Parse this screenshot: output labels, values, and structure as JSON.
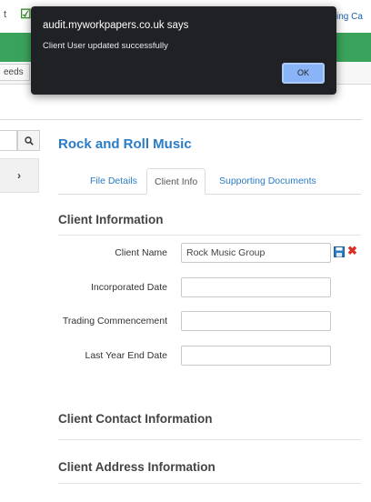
{
  "browser": {
    "bookmark_left": "t",
    "bookmark_right": "ing Ca"
  },
  "header": {
    "tab_label": "eeds"
  },
  "sidebar": {
    "search_icon": "magnifier-icon",
    "expand_icon": "chevron-right-icon"
  },
  "page": {
    "title": "Rock and Roll Music"
  },
  "tabs": [
    {
      "label": "File Details"
    },
    {
      "label": "Client Info"
    },
    {
      "label": "Supporting Documents"
    }
  ],
  "sections": {
    "client_info": "Client Information",
    "contact_info": "Client Contact Information",
    "address_info": "Client Address Information"
  },
  "form": {
    "client_name": {
      "label": "Client Name",
      "value": "Rock Music Group"
    },
    "incorporated_date": {
      "label": "Incorporated Date",
      "value": ""
    },
    "trading_commencement": {
      "label": "Trading Commencement",
      "value": ""
    },
    "last_year_end": {
      "label": "Last Year End Date",
      "value": ""
    }
  },
  "dialog": {
    "title": "audit.myworkpapers.co.uk says",
    "message": "Client User updated successfully",
    "ok_label": "OK"
  },
  "colors": {
    "accent": "#2a7cc7",
    "brand": "#3aa35b",
    "dialog_bg": "#202124",
    "ok_button": "#8ab4f8"
  }
}
